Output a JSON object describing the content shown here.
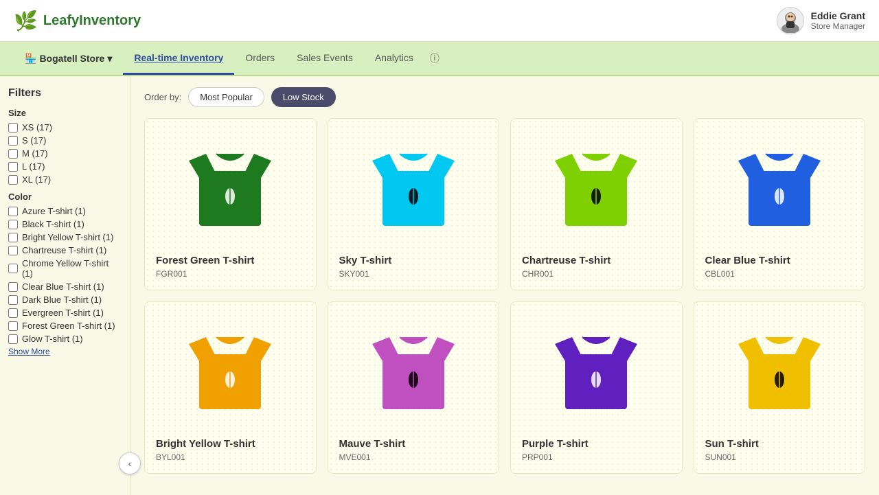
{
  "app": {
    "name": "LeafyInventory",
    "logo_icon": "🌿"
  },
  "user": {
    "name": "Eddie Grant",
    "role": "Store Manager"
  },
  "nav": {
    "store": "Bogatell Store",
    "links": [
      {
        "id": "realtime",
        "label": "Real-time Inventory",
        "active": true
      },
      {
        "id": "orders",
        "label": "Orders",
        "active": false
      },
      {
        "id": "sales",
        "label": "Sales Events",
        "active": false
      },
      {
        "id": "analytics",
        "label": "Analytics",
        "active": false
      }
    ]
  },
  "filters": {
    "title": "Filters",
    "size_title": "Size",
    "sizes": [
      {
        "label": "XS (17)",
        "checked": false
      },
      {
        "label": "S (17)",
        "checked": false
      },
      {
        "label": "M (17)",
        "checked": false
      },
      {
        "label": "L (17)",
        "checked": false
      },
      {
        "label": "XL (17)",
        "checked": false
      }
    ],
    "color_title": "Color",
    "colors": [
      {
        "label": "Azure T-shirt (1)",
        "checked": false
      },
      {
        "label": "Black T-shirt (1)",
        "checked": false
      },
      {
        "label": "Bright Yellow T-shirt (1)",
        "checked": false
      },
      {
        "label": "Chartreuse T-shirt (1)",
        "checked": false
      },
      {
        "label": "Chrome Yellow T-shirt (1)",
        "checked": false
      },
      {
        "label": "Clear Blue T-shirt (1)",
        "checked": false
      },
      {
        "label": "Dark Blue T-shirt (1)",
        "checked": false
      },
      {
        "label": "Evergreen T-shirt (1)",
        "checked": false
      },
      {
        "label": "Forest Green T-shirt (1)",
        "checked": false
      },
      {
        "label": "Glow T-shirt (1)",
        "checked": false
      }
    ],
    "show_more": "Show More"
  },
  "order_by": {
    "label": "Order by:",
    "options": [
      {
        "label": "Most Popular",
        "active": false
      },
      {
        "label": "Low Stock",
        "active": true
      }
    ]
  },
  "products": [
    {
      "name": "Forest Green T-shirt",
      "sku": "FGR001",
      "color": "#1e7a1e",
      "leaf_color": "#ffffff",
      "row": 0
    },
    {
      "name": "Sky T-shirt",
      "sku": "SKY001",
      "color": "#00c8f0",
      "leaf_color": "#000000",
      "row": 0
    },
    {
      "name": "Chartreuse T-shirt",
      "sku": "CHR001",
      "color": "#7fd000",
      "leaf_color": "#000000",
      "row": 0
    },
    {
      "name": "Clear Blue T-shirt",
      "sku": "CBL001",
      "color": "#2060e0",
      "leaf_color": "#ffffff",
      "row": 0
    },
    {
      "name": "Bright Yellow T-shirt",
      "sku": "BYL001",
      "color": "#f0a000",
      "leaf_color": "#ffffff",
      "row": 1
    },
    {
      "name": "Mauve T-shirt",
      "sku": "MVE001",
      "color": "#c050c0",
      "leaf_color": "#000000",
      "row": 1
    },
    {
      "name": "Purple T-shirt",
      "sku": "PRP001",
      "color": "#6020c0",
      "leaf_color": "#ffffff",
      "row": 1
    },
    {
      "name": "Sun T-shirt",
      "sku": "SUN001",
      "color": "#f0c000",
      "leaf_color": "#000000",
      "row": 1
    }
  ],
  "sidebar_toggle_icon": "‹"
}
